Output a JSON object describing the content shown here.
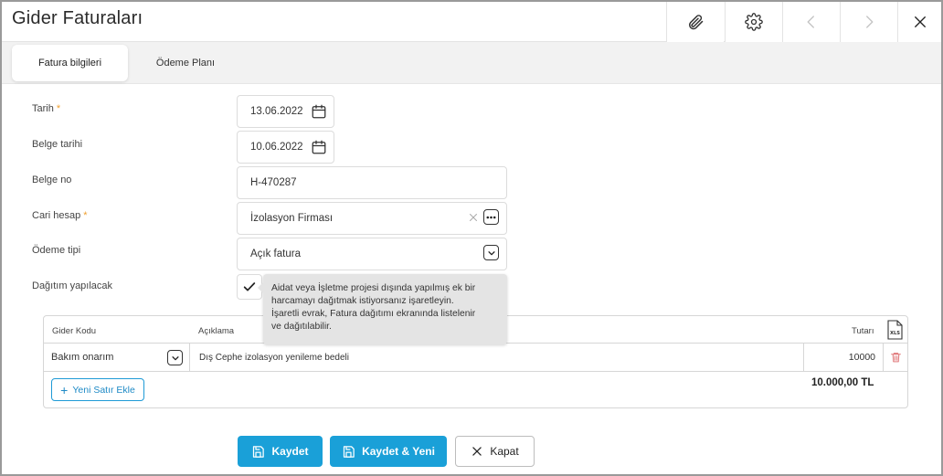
{
  "window": {
    "title": "Gider Faturaları"
  },
  "header_actions": [
    "paperclip-icon",
    "gear-icon",
    "chevron-left-icon",
    "chevron-right-icon",
    "close-icon"
  ],
  "tabs": [
    {
      "label": "Fatura bilgileri",
      "active": true
    },
    {
      "label": "Ödeme Planı",
      "active": false
    }
  ],
  "form": {
    "tarih": {
      "label": "Tarih",
      "required": "*",
      "value": "13.06.2022"
    },
    "belge_tarihi": {
      "label": "Belge tarihi",
      "value": "10.06.2022"
    },
    "belge_no": {
      "label": "Belge no",
      "value": "H-470287"
    },
    "cari_hesap": {
      "label": "Cari hesap",
      "required": "*",
      "value": "İzolasyon Firması"
    },
    "odeme_tipi": {
      "label": "Ödeme tipi",
      "value": "Açık fatura"
    },
    "dagitim": {
      "label": "Dağıtım yapılacak",
      "checked": true
    }
  },
  "tooltip": {
    "text_lines": [
      "Aidat veya İşletme projesi dışında yapılmış ek bir",
      "harcamayı dağıtmak istiyorsanız işaretleyin.",
      "İşaretli evrak, Fatura dağıtımı ekranında listelenir",
      "ve dağıtılabilir."
    ]
  },
  "grid": {
    "columns": {
      "gider_kodu": "Gider Kodu",
      "aciklama": "Açıklama",
      "tutar": "Tutarı"
    },
    "rows": [
      {
        "gider_kodu": "Bakım onarım",
        "aciklama": "Dış Cephe izolasyon yenileme bedeli",
        "tutar": "10000"
      }
    ],
    "add_row_label": "Yeni Satır Ekle",
    "total": "10.000,00 TL"
  },
  "footer": {
    "save_label": "Kaydet",
    "save_new_label": "Kaydet & Yeni",
    "close_label": "Kapat"
  },
  "colors": {
    "primary": "#1aa0d8",
    "required": "#f0a030",
    "delete": "#e0787a",
    "tooltip_bg": "#e4e4e4"
  }
}
